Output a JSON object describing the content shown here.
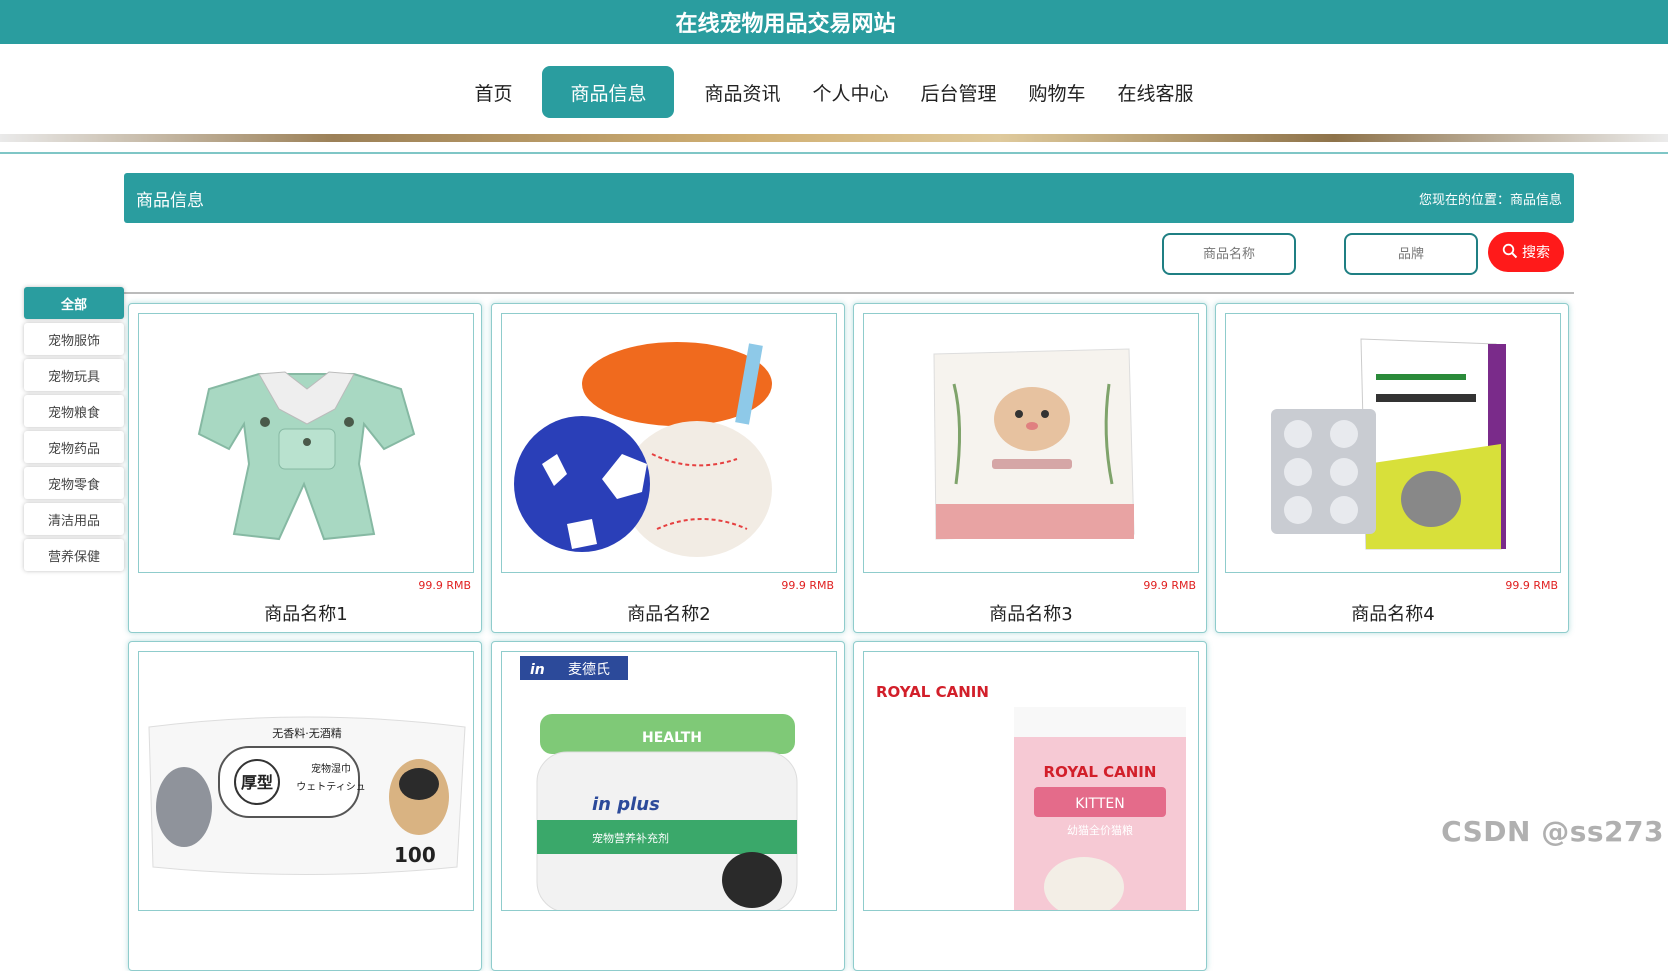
{
  "site": {
    "title": "在线宠物用品交易网站"
  },
  "nav": {
    "items": [
      {
        "label": "首页",
        "active": false
      },
      {
        "label": "商品信息",
        "active": true
      },
      {
        "label": "商品资讯",
        "active": false
      },
      {
        "label": "个人中心",
        "active": false
      },
      {
        "label": "后台管理",
        "active": false
      },
      {
        "label": "购物车",
        "active": false
      },
      {
        "label": "在线客服",
        "active": false
      }
    ]
  },
  "header": {
    "title": "商品信息",
    "breadcrumb": "您现在的位置：商品信息"
  },
  "search": {
    "name_placeholder": "商品名称",
    "brand_placeholder": "品牌",
    "button_label": "搜索"
  },
  "sidebar": {
    "items": [
      {
        "label": "全部",
        "active": true
      },
      {
        "label": "宠物服饰"
      },
      {
        "label": "宠物玩具"
      },
      {
        "label": "宠物粮食"
      },
      {
        "label": "宠物药品"
      },
      {
        "label": "宠物零食"
      },
      {
        "label": "清洁用品"
      },
      {
        "label": "营养保健"
      }
    ]
  },
  "products": [
    {
      "name": "商品名称1",
      "price": "99.9 RMB",
      "image": "pet-clothes-image"
    },
    {
      "name": "商品名称2",
      "price": "99.9 RMB",
      "image": "pet-toy-balls-image"
    },
    {
      "name": "商品名称3",
      "price": "99.9 RMB",
      "image": "pet-food-bag-image"
    },
    {
      "name": "商品名称4",
      "price": "99.9 RMB",
      "image": "pet-medicine-box-image"
    },
    {
      "name": "",
      "price": "",
      "image": "pet-wipes-image",
      "logo_text": "无香料·无酒精",
      "label_text": "宠物湿巾",
      "label_sub": "ウェトティシュ",
      "badge_text": "厚型",
      "count_text": "100"
    },
    {
      "name": "",
      "price": "",
      "image": "pet-supplement-jar-image",
      "brand_text": "麦德氏",
      "brand_logo": "in",
      "product_text": "HEALTH",
      "product_brand": "in plus",
      "label_text": "宠物营养补充剂"
    },
    {
      "name": "",
      "price": "",
      "image": "royal-canin-kitten-image",
      "brand_text": "ROYAL CANIN",
      "product_text": "KITTEN",
      "label_text": "幼猫全价猫粮"
    }
  ],
  "watermark": "CSDN @ss273",
  "colors": {
    "accent": "#2a9d9f",
    "search_button": "#ff1a1a",
    "price": "#e02020"
  }
}
